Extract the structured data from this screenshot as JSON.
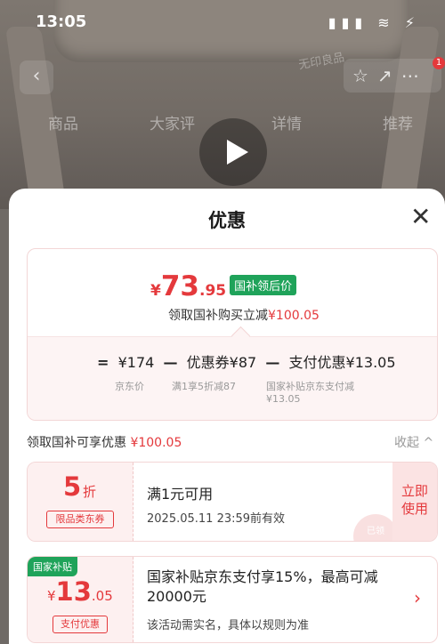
{
  "status_bar": {
    "time": "13:05",
    "icons": "▮▮▮ ≋ ⚡"
  },
  "background": {
    "brand": "无印良品",
    "tabs": [
      "商品",
      "大家评",
      "详情",
      "推荐"
    ],
    "badge": "1"
  },
  "sheet": {
    "title": "优惠",
    "close_icon": "✕"
  },
  "price": {
    "yen": "¥",
    "integer": "73",
    "decimal": ".95",
    "tag": "国补领后价",
    "sub_text": "领取国补购买立减",
    "sub_amount": "¥100.05"
  },
  "formula": {
    "eq": "=",
    "jd_price": "¥174",
    "minus1": "—",
    "coupon": "优惠券¥87",
    "minus2": "—",
    "pay": "支付优惠¥13.05",
    "jd_label": "京东价",
    "coupon_label": "满1享5折减87",
    "pay_label_line1": "国家补贴京东支付减",
    "pay_label_line2": "¥13.05"
  },
  "coupons_header": {
    "text": "领取国补可享优惠",
    "amount": "¥100.05",
    "collapse": "收起 ^"
  },
  "coupon1": {
    "value": "5",
    "unit": "折",
    "tag": "限品类东券",
    "title": "满1元可用",
    "date": "2025.05.11 23:59前有效",
    "button_line1": "立即",
    "button_line2": "使用",
    "stamp": "已领"
  },
  "coupon2": {
    "badge": "国家补贴",
    "yen": "¥",
    "integer": "13",
    "decimal": ".05",
    "tag": "支付优惠",
    "title": "国家补贴京东支付享15%，最高可减20000元",
    "note": "该活动需实名，具体以规则为准",
    "arrow": "›"
  },
  "colors": {
    "accent": "#e4393c",
    "green": "#1fa35a"
  }
}
